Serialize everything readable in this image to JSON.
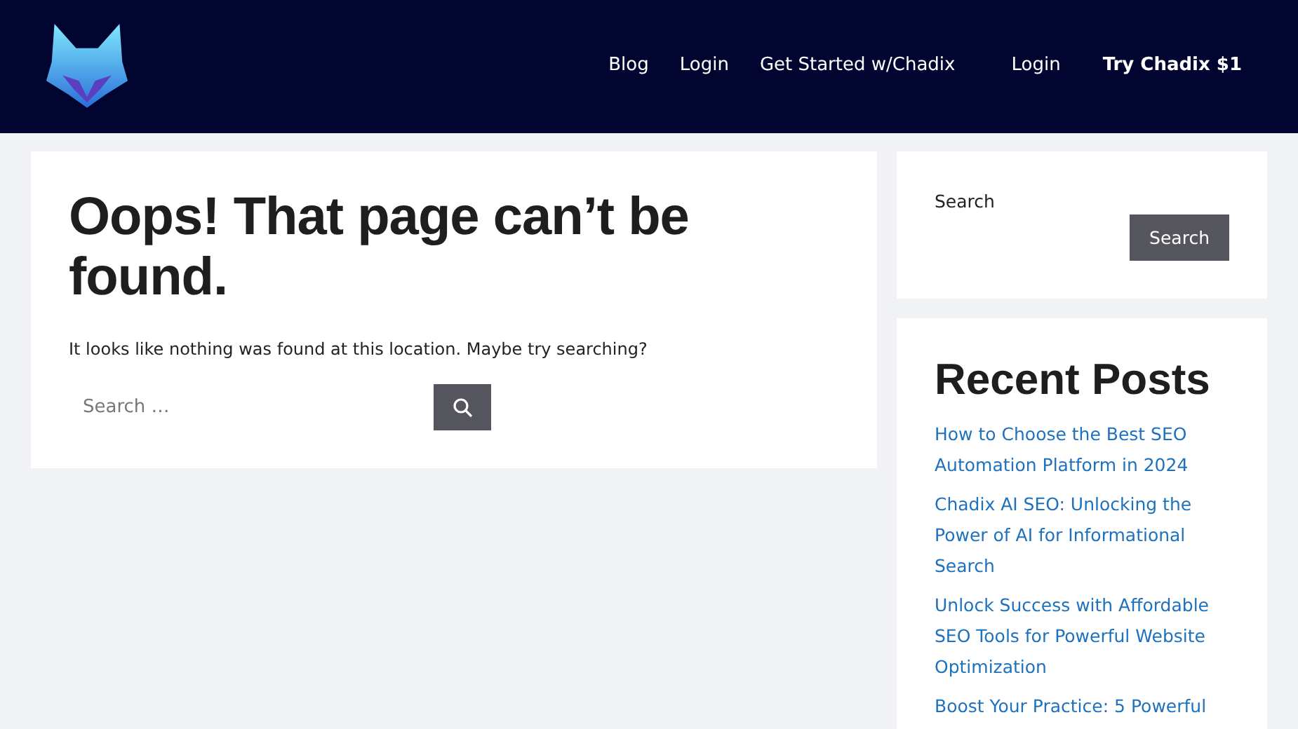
{
  "header": {
    "nav": [
      {
        "label": "Blog",
        "kind": "link"
      },
      {
        "label": "Login",
        "kind": "link"
      },
      {
        "label": "Get Started w/Chadix",
        "kind": "link"
      },
      {
        "label": "Login",
        "kind": "link"
      },
      {
        "label": "Try Chadix $1",
        "kind": "cta"
      }
    ]
  },
  "main": {
    "title": "Oops! That page can’t be found.",
    "message": "It looks like nothing was found at this location. Maybe try searching?",
    "search": {
      "placeholder": "Search …"
    }
  },
  "sidebar": {
    "search_widget": {
      "label": "Search",
      "button": "Search"
    },
    "recent_posts": {
      "title": "Recent Posts",
      "items": [
        "How to Choose the Best SEO Automation Platform in 2024",
        "Chadix AI SEO: Unlocking the Power of AI for Informational Search",
        "Unlock Success with Affordable SEO Tools for Powerful Website Optimization",
        "Boost Your Practice: 5 Powerful"
      ]
    }
  }
}
